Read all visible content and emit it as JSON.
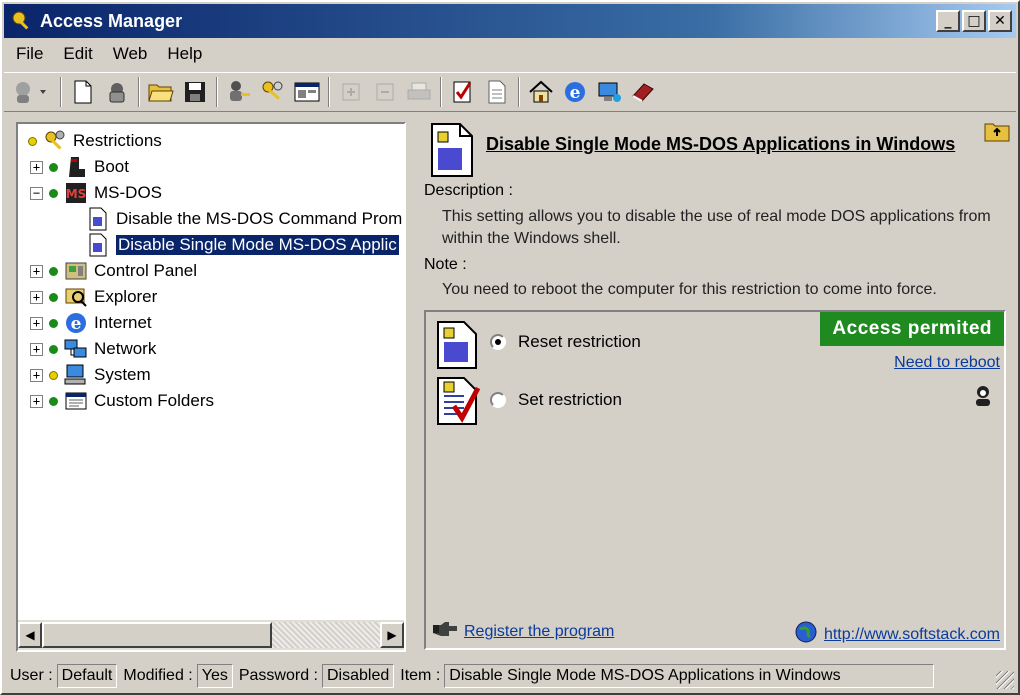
{
  "window": {
    "title": "Access Manager"
  },
  "title_buttons": {
    "minimize": "_",
    "maximize": "□",
    "close": "✕"
  },
  "menu": [
    {
      "label": "File"
    },
    {
      "label": "Edit"
    },
    {
      "label": "Web"
    },
    {
      "label": "Help"
    }
  ],
  "tree": {
    "root": "Restrictions",
    "items": [
      {
        "label": "Boot",
        "expander": "+",
        "dot": "green",
        "icon": "boot-icon"
      },
      {
        "label": "MS-DOS",
        "expander": "−",
        "dot": "green",
        "icon": "msdos-icon",
        "children": [
          {
            "label": "Disable the MS-DOS Command Prom",
            "icon": "document-icon"
          },
          {
            "label": "Disable Single Mode MS-DOS Applic",
            "icon": "document-icon",
            "selected": true
          }
        ]
      },
      {
        "label": "Control Panel",
        "expander": "+",
        "dot": "green",
        "icon": "control-panel-icon"
      },
      {
        "label": "Explorer",
        "expander": "+",
        "dot": "green",
        "icon": "explorer-icon"
      },
      {
        "label": "Internet",
        "expander": "+",
        "dot": "green",
        "icon": "internet-icon"
      },
      {
        "label": "Network",
        "expander": "+",
        "dot": "green",
        "icon": "network-icon"
      },
      {
        "label": "System",
        "expander": "+",
        "dot": "yellow",
        "icon": "system-icon"
      },
      {
        "label": "Custom Folders",
        "expander": "+",
        "dot": "green",
        "icon": "custom-folders-icon"
      }
    ]
  },
  "detail": {
    "title": "Disable Single Mode MS-DOS Applications in Windows",
    "description_label": "Description :",
    "description_text": "This setting allows you to disable the use of real mode DOS applications from within the Windows shell.",
    "note_label": "Note :",
    "note_text": "You need to reboot the computer for this restriction to come into force.",
    "reset_label": "Reset restriction",
    "set_label": "Set restriction",
    "status_badge": "Access permited",
    "reboot_link": "Need to reboot",
    "register_link": "Register the program",
    "website_link": "http://www.softstack.com"
  },
  "statusbar": {
    "user_label": "User :",
    "user_value": "Default",
    "modified_label": "Modified :",
    "modified_value": "Yes",
    "password_label": "Password :",
    "password_value": "Disabled",
    "item_label": "Item :",
    "item_value": "Disable Single Mode MS-DOS Applications in Windows"
  },
  "colors": {
    "badge_bg": "#1f8a1f",
    "selection_bg": "#0a246a",
    "title_gradient_start": "#0a246a",
    "link": "#0a3a9a"
  }
}
